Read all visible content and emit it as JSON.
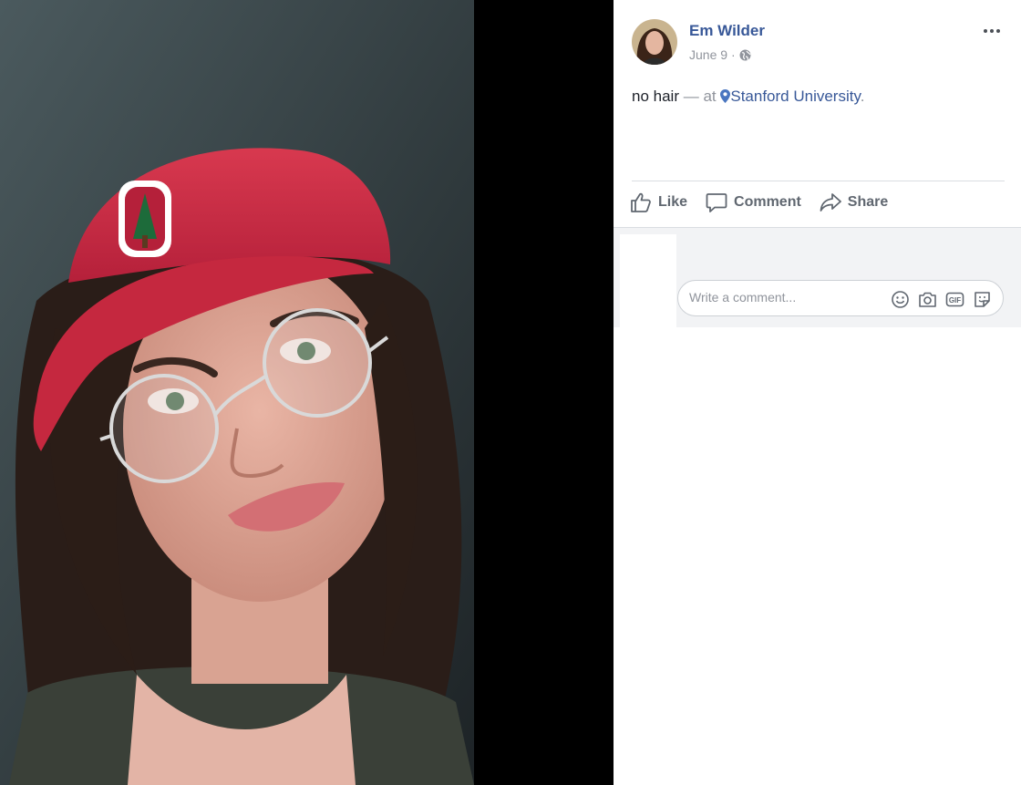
{
  "post": {
    "author": "Em Wilder",
    "date": "June 9",
    "dot": "·",
    "privacy_icon": "globe-icon",
    "caption": {
      "text": "no hair",
      "separator": "— at",
      "location": "Stanford University",
      "end": "."
    }
  },
  "actions": {
    "like": "Like",
    "comment": "Comment",
    "share": "Share"
  },
  "comment_box": {
    "placeholder": "Write a comment...",
    "icons": [
      "emoji-icon",
      "camera-icon",
      "gif-icon",
      "sticker-icon"
    ],
    "gif_text": "GIF"
  },
  "colors": {
    "link_blue": "#385898",
    "muted_gray": "#90949c",
    "action_gray": "#606770",
    "cap_red": "#c8283f"
  }
}
